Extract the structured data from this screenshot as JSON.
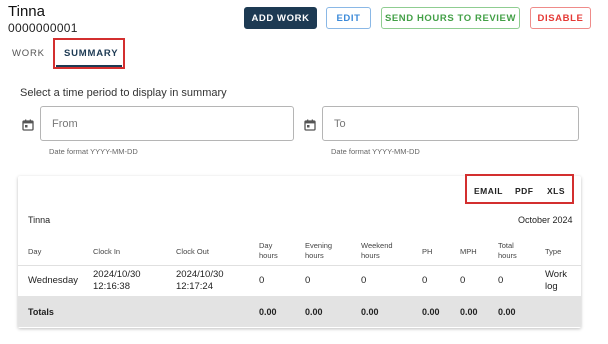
{
  "header": {
    "name": "Tinna",
    "id": "0000000001"
  },
  "actions": {
    "add_work": "ADD WORK",
    "edit": "EDIT",
    "send_hours": "SEND HOURS TO REVIEW",
    "disable": "DISABLE"
  },
  "tabs": [
    {
      "label": "WORK",
      "active": false
    },
    {
      "label": "SUMMARY",
      "active": true
    }
  ],
  "period": {
    "label": "Select a time period to display in summary",
    "from_placeholder": "From",
    "to_placeholder": "To",
    "hint": "Date format YYYY-MM-DD",
    "icon": "calendar-icon"
  },
  "summary": {
    "export": [
      "EMAIL",
      "PDF",
      "XLS"
    ],
    "name": "Tinna",
    "month": "October 2024",
    "columns": [
      "Day",
      "Clock In",
      "Clock Out",
      "Day hours",
      "Evening hours",
      "Weekend hours",
      "PH",
      "MPH",
      "Total hours",
      "Type"
    ],
    "rows": [
      {
        "day": "Wednesday",
        "clock_in": "2024/10/30 12:16:38",
        "clock_out": "2024/10/30 12:17:24",
        "day_hours": "0",
        "evening_hours": "0",
        "weekend_hours": "0",
        "ph": "0",
        "mph": "0",
        "total_hours": "0",
        "type": "Work log"
      }
    ],
    "totals": {
      "label": "Totals",
      "day_hours": "0.00",
      "evening_hours": "0.00",
      "weekend_hours": "0.00",
      "ph": "0.00",
      "mph": "0.00",
      "total_hours": "0.00"
    }
  },
  "colors": {
    "primary": "#1d3a53",
    "edit": "#3b8ad9",
    "send": "#43a047",
    "disable": "#e53935",
    "highlight": "#d32f2f"
  }
}
